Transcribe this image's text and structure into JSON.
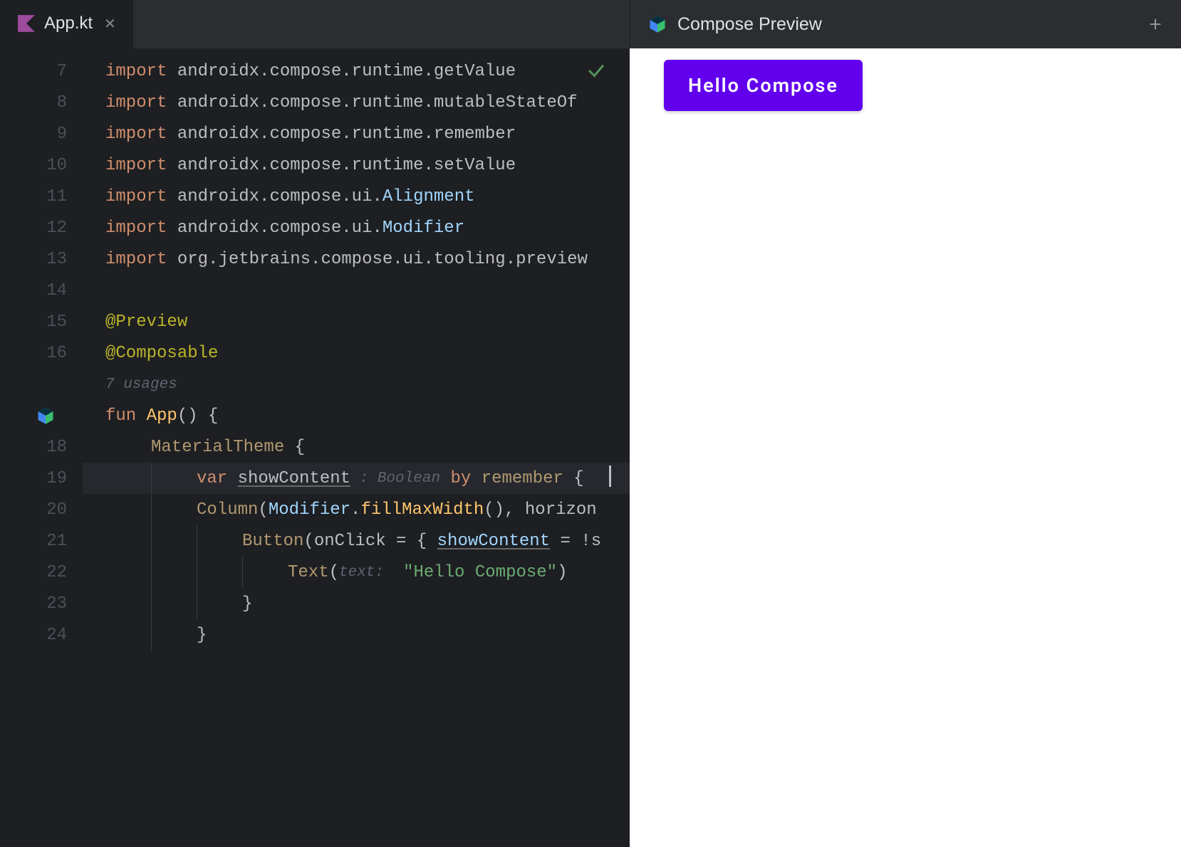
{
  "editor": {
    "tab": {
      "filename": "App.kt"
    },
    "lines": [
      {
        "n": "7",
        "tokens": [
          {
            "t": "import ",
            "c": "kw"
          },
          {
            "t": "androidx.compose.runtime.",
            "c": "ident"
          },
          {
            "t": "getValue",
            "c": "ident"
          }
        ]
      },
      {
        "n": "8",
        "tokens": [
          {
            "t": "import ",
            "c": "kw"
          },
          {
            "t": "androidx.compose.runtime.",
            "c": "ident"
          },
          {
            "t": "mutableStateOf",
            "c": "ident"
          }
        ]
      },
      {
        "n": "9",
        "tokens": [
          {
            "t": "import ",
            "c": "kw"
          },
          {
            "t": "androidx.compose.runtime.",
            "c": "ident"
          },
          {
            "t": "remember",
            "c": "ident"
          }
        ]
      },
      {
        "n": "10",
        "tokens": [
          {
            "t": "import ",
            "c": "kw"
          },
          {
            "t": "androidx.compose.runtime.",
            "c": "ident"
          },
          {
            "t": "setValue",
            "c": "ident"
          }
        ]
      },
      {
        "n": "11",
        "tokens": [
          {
            "t": "import ",
            "c": "kw"
          },
          {
            "t": "androidx.compose.ui.",
            "c": "ident"
          },
          {
            "t": "Alignment",
            "c": "name-suffix"
          }
        ]
      },
      {
        "n": "12",
        "tokens": [
          {
            "t": "import ",
            "c": "kw"
          },
          {
            "t": "androidx.compose.ui.",
            "c": "ident"
          },
          {
            "t": "Modifier",
            "c": "name-suffix"
          }
        ]
      },
      {
        "n": "13",
        "tokens": [
          {
            "t": "import ",
            "c": "kw"
          },
          {
            "t": "org.jetbrains.compose.ui.tooling.preview",
            "c": "ident"
          }
        ]
      },
      {
        "n": "14",
        "tokens": []
      },
      {
        "n": "15",
        "tokens": [
          {
            "t": "@Preview",
            "c": "ann"
          }
        ]
      },
      {
        "n": "16",
        "tokens": [
          {
            "t": "@Composable",
            "c": "ann"
          }
        ]
      },
      {
        "n": "",
        "tokens": [
          {
            "t": "7 usages",
            "c": "inlay"
          }
        ],
        "inlay": true
      },
      {
        "n": "",
        "gIcon": true,
        "tokens": [
          {
            "t": "fun ",
            "c": "kw"
          },
          {
            "t": "App",
            "c": "fn2"
          },
          {
            "t": "() {",
            "c": "op"
          }
        ]
      },
      {
        "n": "18",
        "indent": 1,
        "tokens": [
          {
            "t": "MaterialTheme",
            "c": "prop-fn"
          },
          {
            "t": " {",
            "c": "op"
          }
        ]
      },
      {
        "n": "19",
        "indent": 2,
        "current": true,
        "caret": true,
        "tokens": [
          {
            "t": "var ",
            "c": "kw"
          },
          {
            "t": "showContent",
            "c": "ident underline"
          },
          {
            "t": " : Boolean",
            "c": "inlay"
          },
          {
            "t": " by ",
            "c": "kw"
          },
          {
            "t": "remember",
            "c": "prop-fn"
          },
          {
            "t": " {",
            "c": "op"
          }
        ]
      },
      {
        "n": "20",
        "indent": 2,
        "tokens": [
          {
            "t": "Column",
            "c": "prop-fn"
          },
          {
            "t": "(",
            "c": "op"
          },
          {
            "t": "Modifier",
            "c": "name-suffix"
          },
          {
            "t": ".",
            "c": "op"
          },
          {
            "t": "fillMaxWidth",
            "c": "fn2"
          },
          {
            "t": "(), ",
            "c": "op"
          },
          {
            "t": "horizon",
            "c": "ident"
          }
        ]
      },
      {
        "n": "21",
        "indent": 3,
        "tokens": [
          {
            "t": "Button",
            "c": "prop-fn"
          },
          {
            "t": "(onClick = { ",
            "c": "op"
          },
          {
            "t": "showContent",
            "c": "name-suffix underline"
          },
          {
            "t": " = !s",
            "c": "op"
          }
        ]
      },
      {
        "n": "22",
        "indent": 4,
        "tokens": [
          {
            "t": "Text",
            "c": "prop-fn"
          },
          {
            "t": "(",
            "c": "op"
          },
          {
            "t": "text: ",
            "c": "inlay"
          },
          {
            "t": " \"Hello Compose\"",
            "c": "str"
          },
          {
            "t": ")",
            "c": "op"
          }
        ]
      },
      {
        "n": "23",
        "indent": 3,
        "tokens": [
          {
            "t": "}",
            "c": "op"
          }
        ]
      },
      {
        "n": "24",
        "indent": 2,
        "tokens": [
          {
            "t": "}",
            "c": "op"
          }
        ]
      }
    ]
  },
  "preview": {
    "title": "Compose Preview",
    "button_text": "Hello Compose"
  }
}
